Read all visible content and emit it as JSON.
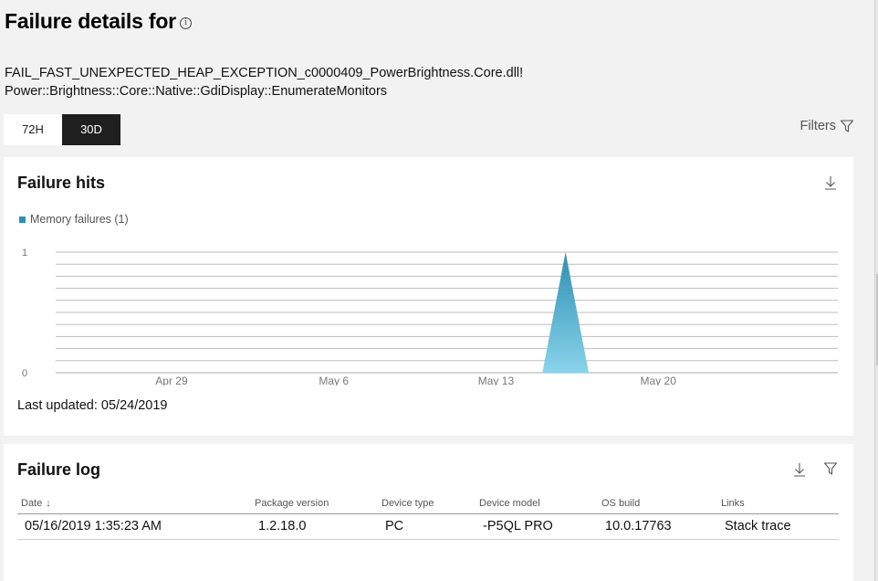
{
  "page": {
    "title": "Failure details for",
    "failure_name_line1": "FAIL_FAST_UNEXPECTED_HEAP_EXCEPTION_c0000409_PowerBrightness.Core.dll!",
    "failure_name_line2": "Power::Brightness::Core::Native::GdiDisplay::EnumerateMonitors"
  },
  "time_toggle": {
    "options": [
      "72H",
      "30D"
    ],
    "selected": "30D"
  },
  "filters_label": "Filters",
  "failure_hits": {
    "title": "Failure hits",
    "last_updated": "Last updated: 05/24/2019"
  },
  "chart_data": {
    "type": "area",
    "title": "Failure hits",
    "series": [
      {
        "name": "Memory failures (1)",
        "color": "#2e8fb3",
        "points": [
          {
            "x": "2019-05-15",
            "y": 0
          },
          {
            "x": "2019-05-16",
            "y": 1
          },
          {
            "x": "2019-05-17",
            "y": 0
          }
        ]
      }
    ],
    "x_ticks": [
      "Apr 29",
      "May 6",
      "May 13",
      "May 20"
    ],
    "y_ticks": [
      "0",
      "1"
    ],
    "ylim": [
      0,
      1
    ],
    "grid": true,
    "legend_position": "top-left"
  },
  "failure_log": {
    "title": "Failure log",
    "columns": [
      "Date",
      "Package version",
      "Device type",
      "Device model",
      "OS build",
      "Links"
    ],
    "rows": [
      [
        "05/16/2019 1:35:23 AM",
        "1.2.18.0",
        "PC",
        "-P5QL PRO",
        "10.0.17763",
        "Stack trace"
      ]
    ]
  }
}
